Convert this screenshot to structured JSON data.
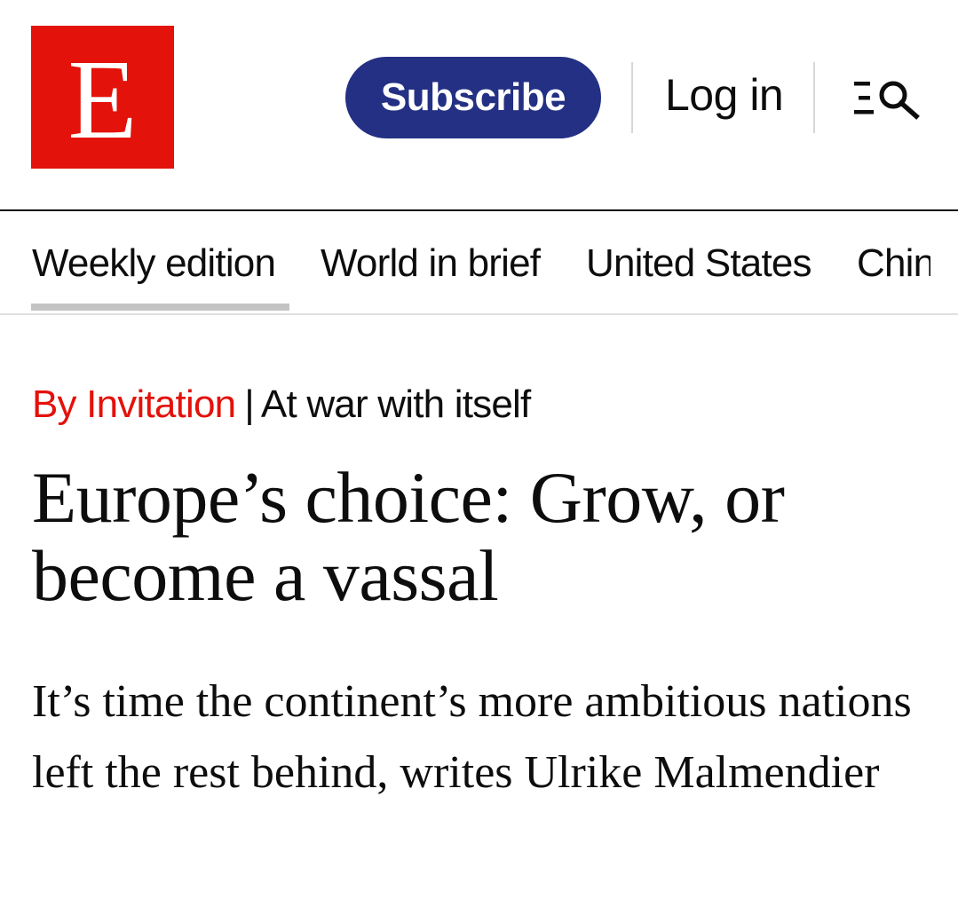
{
  "header": {
    "logo_letter": "E",
    "subscribe_label": "Subscribe",
    "login_label": "Log in",
    "menu_icon": "menu-search-icon"
  },
  "nav": {
    "items": [
      {
        "label": "Weekly edition",
        "active": true
      },
      {
        "label": "World in brief"
      },
      {
        "label": "United States"
      },
      {
        "label": "China"
      }
    ]
  },
  "article": {
    "section": "By Invitation",
    "separator": "|",
    "flytitle": "At war with itself",
    "headline": "Europe’s choice: Grow, or become a vassal",
    "standfirst": "It’s time the continent’s more ambitious nations left the rest behind, writes Ulrike Malmendier"
  },
  "colors": {
    "brand_red": "#e3120b",
    "subscribe_navy": "#233083",
    "text": "#0d0d0d"
  }
}
